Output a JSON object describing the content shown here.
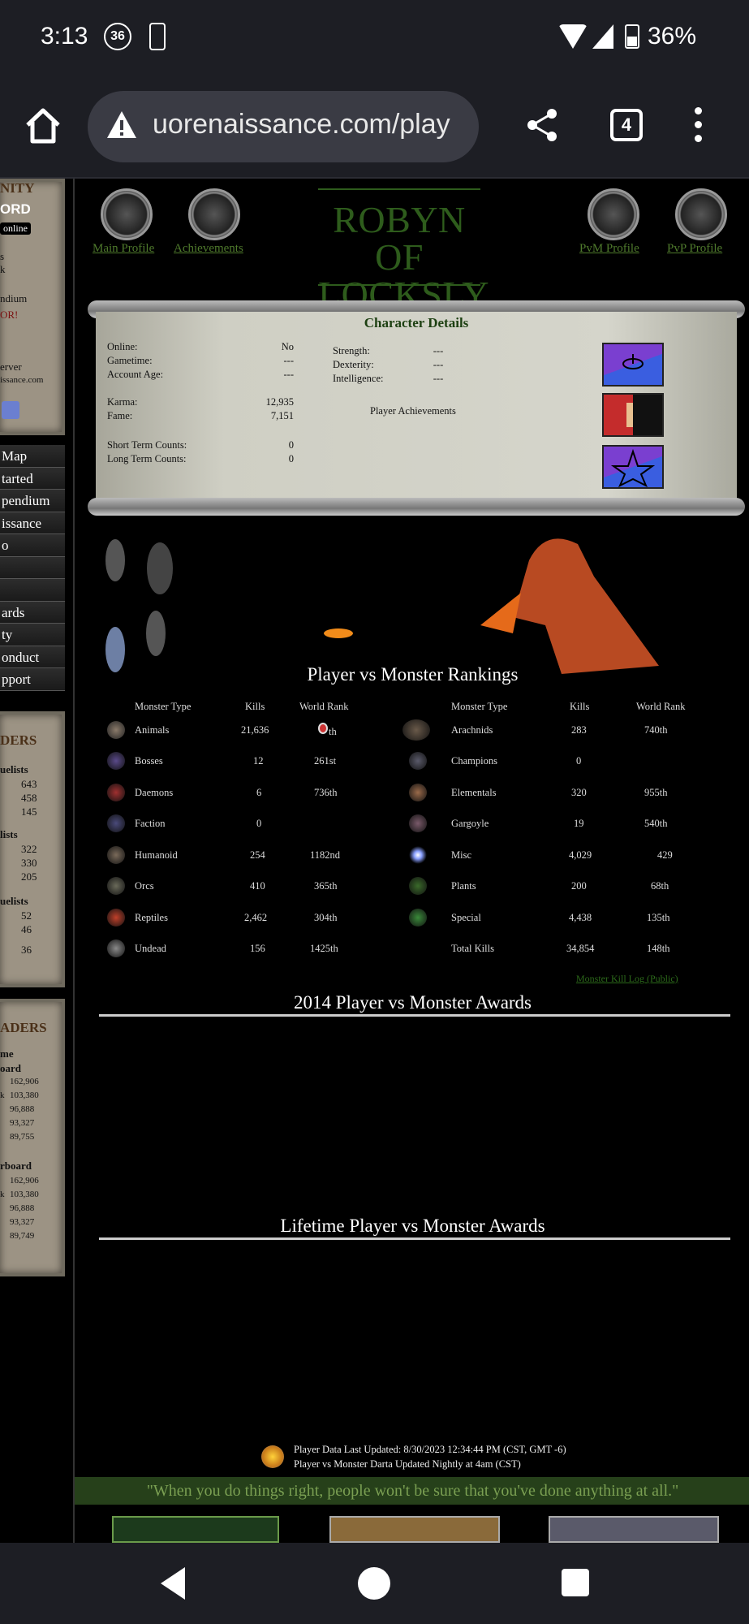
{
  "status_bar": {
    "time": "3:13",
    "notif_count": "36",
    "battery": "36%"
  },
  "browser": {
    "url": "uorenaissance.com/play",
    "tab_count": "4"
  },
  "sidebar": {
    "panel1": {
      "head": "NITY",
      "badge": "ORD",
      "online": "online",
      "l1": "s",
      "l2": "k",
      "l3": "ndium",
      "l4": "OR!",
      "l5": "erver",
      "l6": "issance.com"
    },
    "nav_items": [
      "Map",
      "tarted",
      "pendium",
      "issance",
      "o",
      "",
      "",
      "ards",
      "ty",
      "onduct",
      "pport"
    ],
    "panel2": {
      "head": "DERS",
      "g1": "uelists",
      "g1_vals": [
        "643",
        "458",
        "145"
      ],
      "g2": "lists",
      "g2_vals": [
        "322",
        "330",
        "205"
      ],
      "g3": "uelists",
      "g3_vals": [
        "52",
        "46",
        "36"
      ]
    },
    "panel3": {
      "head": "ADERS",
      "g1a": "me",
      "g1b": "oard",
      "g1_vals": [
        "162,906",
        "103,380",
        "96,888",
        "93,327",
        "89,755"
      ],
      "g2": "rboard",
      "g2_vals": [
        "162,906",
        "103,380",
        "96,888",
        "93,327",
        "89,749"
      ],
      "k1": "k",
      "k2": "k"
    }
  },
  "profile_nav": {
    "main_profile": "Main Profile",
    "achievements": "Achievements",
    "pvm_profile": "PvM Profile",
    "pvp_profile": "PvP Profile"
  },
  "character": {
    "name_line1": "ROBYN OF",
    "name_line2": "LOCKSLY",
    "details_title": "Character Details",
    "online_label": "Online:",
    "online_value": "No",
    "gametime_label": "Gametime:",
    "gametime_value": "---",
    "account_age_label": "Account Age:",
    "account_age_value": "---",
    "karma_label": "Karma:",
    "karma_value": "12,935",
    "fame_label": "Fame:",
    "fame_value": "7,151",
    "short_term_label": "Short Term Counts:",
    "short_term_value": "0",
    "long_term_label": "Long Term Counts:",
    "long_term_value": "0",
    "strength_label": "Strength:",
    "strength_value": "---",
    "dexterity_label": "Dexterity:",
    "dexterity_value": "---",
    "intelligence_label": "Intelligence:",
    "intelligence_value": "---",
    "achievements_label": "Player Achievements"
  },
  "pvm": {
    "title": "Player vs Monster Rankings",
    "headers": {
      "type": "Monster Type",
      "kills": "Kills",
      "rank": "World Rank"
    },
    "left": [
      {
        "type": "Animals",
        "kills": "21,636",
        "rank": "th",
        "icon": "wolf-icon"
      },
      {
        "type": "Bosses",
        "kills": "12",
        "rank": "261st",
        "icon": "boss-icon"
      },
      {
        "type": "Daemons",
        "kills": "6",
        "rank": "736th",
        "icon": "daemon-icon"
      },
      {
        "type": "Faction",
        "kills": "0",
        "rank": "",
        "icon": "faction-icon"
      },
      {
        "type": "Humanoid",
        "kills": "254",
        "rank": "1182nd",
        "icon": "humanoid-icon"
      },
      {
        "type": "Orcs",
        "kills": "410",
        "rank": "365th",
        "icon": "orc-icon"
      },
      {
        "type": "Reptiles",
        "kills": "2,462",
        "rank": "304th",
        "icon": "dragon-icon"
      },
      {
        "type": "Undead",
        "kills": "156",
        "rank": "1425th",
        "icon": "skeleton-icon"
      }
    ],
    "right": [
      {
        "type": "Arachnids",
        "kills": "283",
        "rank": "740th",
        "icon": "spider-icon"
      },
      {
        "type": "Champions",
        "kills": "0",
        "rank": "",
        "icon": "champion-icon"
      },
      {
        "type": "Elementals",
        "kills": "320",
        "rank": "955th",
        "icon": "elemental-icon"
      },
      {
        "type": "Gargoyle",
        "kills": "19",
        "rank": "540th",
        "icon": "gargoyle-icon"
      },
      {
        "type": "Misc",
        "kills": "4,029",
        "rank": "429",
        "icon": "wisp-icon"
      },
      {
        "type": "Plants",
        "kills": "200",
        "rank": "68th",
        "icon": "plant-icon"
      },
      {
        "type": "Special",
        "kills": "4,438",
        "rank": "135th",
        "icon": "special-icon"
      },
      {
        "type": "Total Kills",
        "kills": "34,854",
        "rank": "148th",
        "icon": ""
      }
    ],
    "kill_log_link": "Monster Kill Log (Public)"
  },
  "awards": {
    "year_title": "2014 Player vs Monster Awards",
    "lifetime_title": "Lifetime Player vs Monster Awards"
  },
  "footer": {
    "updated_line": "Player Data Last Updated: 8/30/2023 12:34:44 PM (CST, GMT -6)",
    "nightly_line": "Player vs Monster Darta Updated Nightly at 4am (CST)",
    "quote": "\"When you do things right, people won't be sure that you've done anything at all.\""
  },
  "colors": {
    "accent_green": "#4f7a2c",
    "title_green": "#2e5c1c",
    "background": "#000000"
  }
}
